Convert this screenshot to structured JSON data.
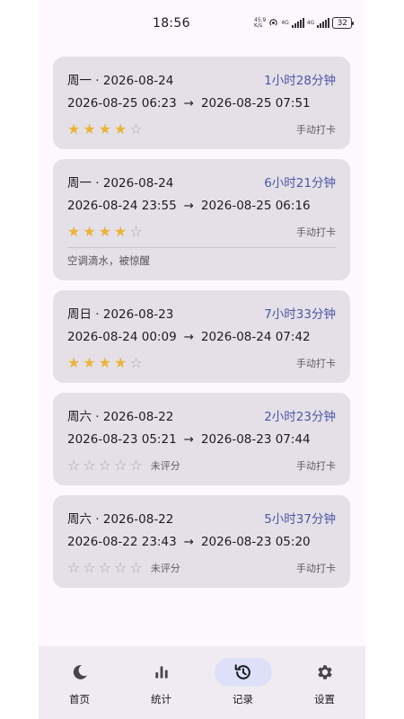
{
  "status_bar": {
    "time": "18:56",
    "net_speed_value": "45.9",
    "net_speed_unit": "K/s",
    "network_type_1": "4G",
    "network_type_2": "4G",
    "battery": "32"
  },
  "records": [
    {
      "date": "周一 · 2026-08-24",
      "duration": "1小时28分钟",
      "start": "2026-08-25 06:23",
      "end": "2026-08-25 07:51",
      "rating": 4,
      "unrated_label": "",
      "method": "手动打卡",
      "note": ""
    },
    {
      "date": "周一 · 2026-08-24",
      "duration": "6小时21分钟",
      "start": "2026-08-24 23:55",
      "end": "2026-08-25 06:16",
      "rating": 4,
      "unrated_label": "",
      "method": "手动打卡",
      "note": "空调滴水，被惊醒"
    },
    {
      "date": "周日 · 2026-08-23",
      "duration": "7小时33分钟",
      "start": "2026-08-24 00:09",
      "end": "2026-08-24 07:42",
      "rating": 4,
      "unrated_label": "",
      "method": "手动打卡",
      "note": ""
    },
    {
      "date": "周六 · 2026-08-22",
      "duration": "2小时23分钟",
      "start": "2026-08-23 05:21",
      "end": "2026-08-23 07:44",
      "rating": 0,
      "unrated_label": "未评分",
      "method": "手动打卡",
      "note": ""
    },
    {
      "date": "周六 · 2026-08-22",
      "duration": "5小时37分钟",
      "start": "2026-08-22 23:43",
      "end": "2026-08-23 05:20",
      "rating": 0,
      "unrated_label": "未评分",
      "method": "手动打卡",
      "note": ""
    }
  ],
  "arrow": "→",
  "nav": {
    "items": [
      {
        "label": "首页",
        "icon": "moon-icon",
        "active": false
      },
      {
        "label": "统计",
        "icon": "bar-chart-icon",
        "active": false
      },
      {
        "label": "记录",
        "icon": "history-icon",
        "active": true
      },
      {
        "label": "设置",
        "icon": "gear-icon",
        "active": false
      }
    ]
  },
  "colors": {
    "duration": "#4a57a6",
    "star_on": "#e8b43c",
    "star_off": "#aaa6b0",
    "card_bg": "#e5e0e7",
    "nav_active_bg": "#dde0f8"
  }
}
